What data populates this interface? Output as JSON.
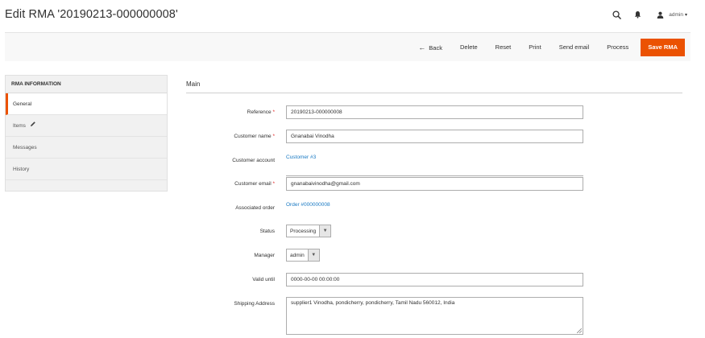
{
  "page": {
    "title": "Edit RMA '20190213-000000008'"
  },
  "header": {
    "user_name": "admin",
    "caret": "▾"
  },
  "actions": {
    "back": "Back",
    "delete": "Delete",
    "reset": "Reset",
    "print": "Print",
    "send_email": "Send email",
    "process": "Process",
    "save": "Save RMA"
  },
  "tabs": {
    "title": "RMA INFORMATION",
    "items": [
      {
        "label": "General"
      },
      {
        "label": "Items"
      },
      {
        "label": "Messages"
      },
      {
        "label": "History"
      }
    ]
  },
  "main": {
    "section_title": "Main",
    "fields": {
      "reference": {
        "label": "Reference",
        "value": "20190213-000000008"
      },
      "customer_name": {
        "label": "Customer name",
        "value": "Gnanabai Vinodha"
      },
      "customer_account": {
        "label": "Customer account",
        "value": "Customer #3"
      },
      "customer_email": {
        "label": "Customer email",
        "value": "gnanabaivinodha@gmail.com"
      },
      "associated_order": {
        "label": "Associated order",
        "value": "Order #000000008"
      },
      "status": {
        "label": "Status",
        "value": "Processing"
      },
      "manager": {
        "label": "Manager",
        "value": "admin"
      },
      "valid_until": {
        "label": "Valid until",
        "value": "0000-00-00 00:00:00"
      },
      "shipping_address": {
        "label": "Shipping Address",
        "value": "supplier1 Vinodha, pondicherry, pondicherry, Tamil Nadu 560012, India"
      }
    }
  },
  "colors": {
    "accent": "#eb5202",
    "link": "#1979c3",
    "required": "#e22626"
  }
}
